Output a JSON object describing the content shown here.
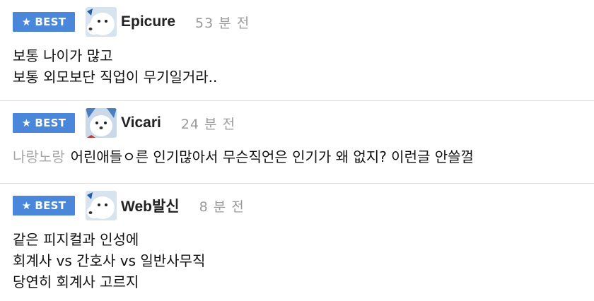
{
  "comments": [
    {
      "badge": "BEST",
      "nickname": "Epicure",
      "time": "53 분 전",
      "lines": [
        "보통 나이가 많고",
        "보통 외모보단 직업이 무기일거라.."
      ]
    },
    {
      "badge": "BEST",
      "nickname": "Vicari",
      "time": "24 분 전",
      "mention": "나랑노랑",
      "text": "어린애들ㅇ른 인기많아서 무슨직언은 인기가 왜 없지? 이런글 안쓸껄"
    },
    {
      "badge": "BEST",
      "nickname": "Web발신",
      "time": "8 분 전",
      "lines": [
        "같은 피지컬과 인성에",
        "회계사 vs 간호사 vs 일반사무직",
        "당연히 회계사 고르지"
      ]
    }
  ],
  "icons": {
    "badge_icon": "star-icon",
    "avatar": "white-dog-avatar"
  },
  "colors": {
    "badge_bg": "#4a86d9",
    "time": "#9a9a9a",
    "mention": "#a8a8a8",
    "divider": "#dcdfe3"
  }
}
